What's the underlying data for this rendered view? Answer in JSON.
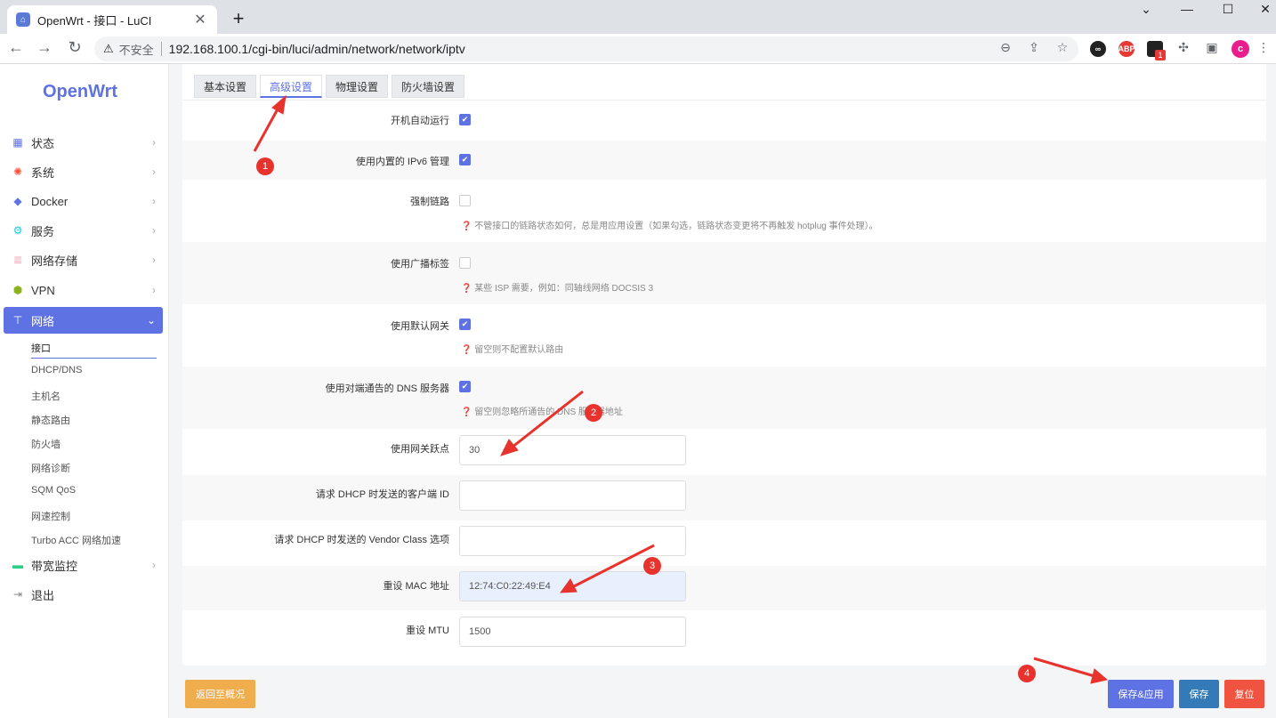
{
  "browser": {
    "tab_title": "OpenWrt - 接口 - LuCI",
    "tab_close": "✕",
    "new_tab": "+",
    "insecure_label": "不安全",
    "url": "192.168.100.1/cgi-bin/luci/admin/network/network/iptv",
    "ext_badge": "1",
    "profile_initial": "c"
  },
  "sidebar": {
    "logo": "OpenWrt",
    "menu": [
      {
        "label": "状态",
        "icon": "dashboard-icon"
      },
      {
        "label": "系统",
        "icon": "gear-icon"
      },
      {
        "label": "Docker",
        "icon": "docker-icon"
      },
      {
        "label": "服务",
        "icon": "services-icon"
      },
      {
        "label": "网络存储",
        "icon": "storage-icon"
      },
      {
        "label": "VPN",
        "icon": "vpn-icon"
      },
      {
        "label": "网络",
        "icon": "network-icon"
      }
    ],
    "submenu": [
      "接口",
      "DHCP/DNS",
      "主机名",
      "静态路由",
      "防火墙",
      "网络诊断",
      "SQM QoS",
      "网速控制",
      "Turbo ACC 网络加速"
    ],
    "menu_after": [
      {
        "label": "带宽监控",
        "icon": "bandwidth-icon"
      },
      {
        "label": "退出",
        "icon": "logout-icon"
      }
    ]
  },
  "tabs": [
    "基本设置",
    "高级设置",
    "物理设置",
    "防火墙设置"
  ],
  "form": {
    "autostart": "开机自动运行",
    "ipv6": "使用内置的 IPv6 管理",
    "force_link": "强制链路",
    "force_link_hint": "不管接口的链路状态如何，总是用应用设置（如果勾选，链路状态变更将不再触发 hotplug 事件处理）。",
    "broadcast": "使用广播标签",
    "broadcast_hint": "某些 ISP 需要，例如：同轴线网络 DOCSIS 3",
    "default_gw": "使用默认网关",
    "default_gw_hint": "留空则不配置默认路由",
    "peer_dns": "使用对端通告的 DNS 服务器",
    "peer_dns_hint": "留空则忽略所通告的 DNS 服务器地址",
    "metric": "使用网关跃点",
    "metric_value": "30",
    "client_id": "请求 DHCP 时发送的客户端 ID",
    "vendor_class": "请求 DHCP 时发送的 Vendor Class 选项",
    "mac": "重设 MAC 地址",
    "mac_value": "12:74:C0:22:49:E4",
    "mtu": "重设 MTU",
    "mtu_value": "1500"
  },
  "buttons": {
    "back": "返回至概况",
    "save_apply": "保存&应用",
    "save": "保存",
    "reset": "复位"
  },
  "annotations": [
    "1",
    "2",
    "3",
    "4"
  ],
  "colors": {
    "accent": "#5e72e4",
    "warning": "#f0ad4e",
    "save": "#337ab7",
    "reset": "#f0533f",
    "annotation": "#e8322d"
  }
}
